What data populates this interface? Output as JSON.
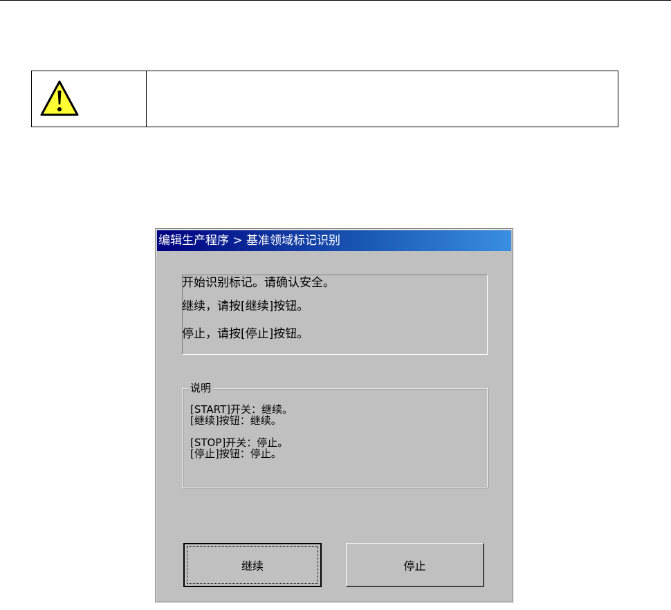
{
  "warning": {
    "icon": "warning-triangle-icon",
    "icon_color": "#ffff33",
    "text": ""
  },
  "dialog": {
    "title": "编辑生产程序 > 基准领域标记识别",
    "titlebar_color": "#000080",
    "message_lines": [
      "开始识别标记。请确认安全。",
      "继续，请按[继续]按钮。",
      "停止，请按[停止]按钮。"
    ],
    "help": {
      "legend": "说明",
      "lines": [
        "[START]开关：继续。",
        "[继续]按钮：继续。",
        "[STOP]开关：停止。",
        "[停止]按钮：停止。"
      ]
    },
    "buttons": {
      "continue_label": "继续",
      "stop_label": "停止"
    }
  }
}
